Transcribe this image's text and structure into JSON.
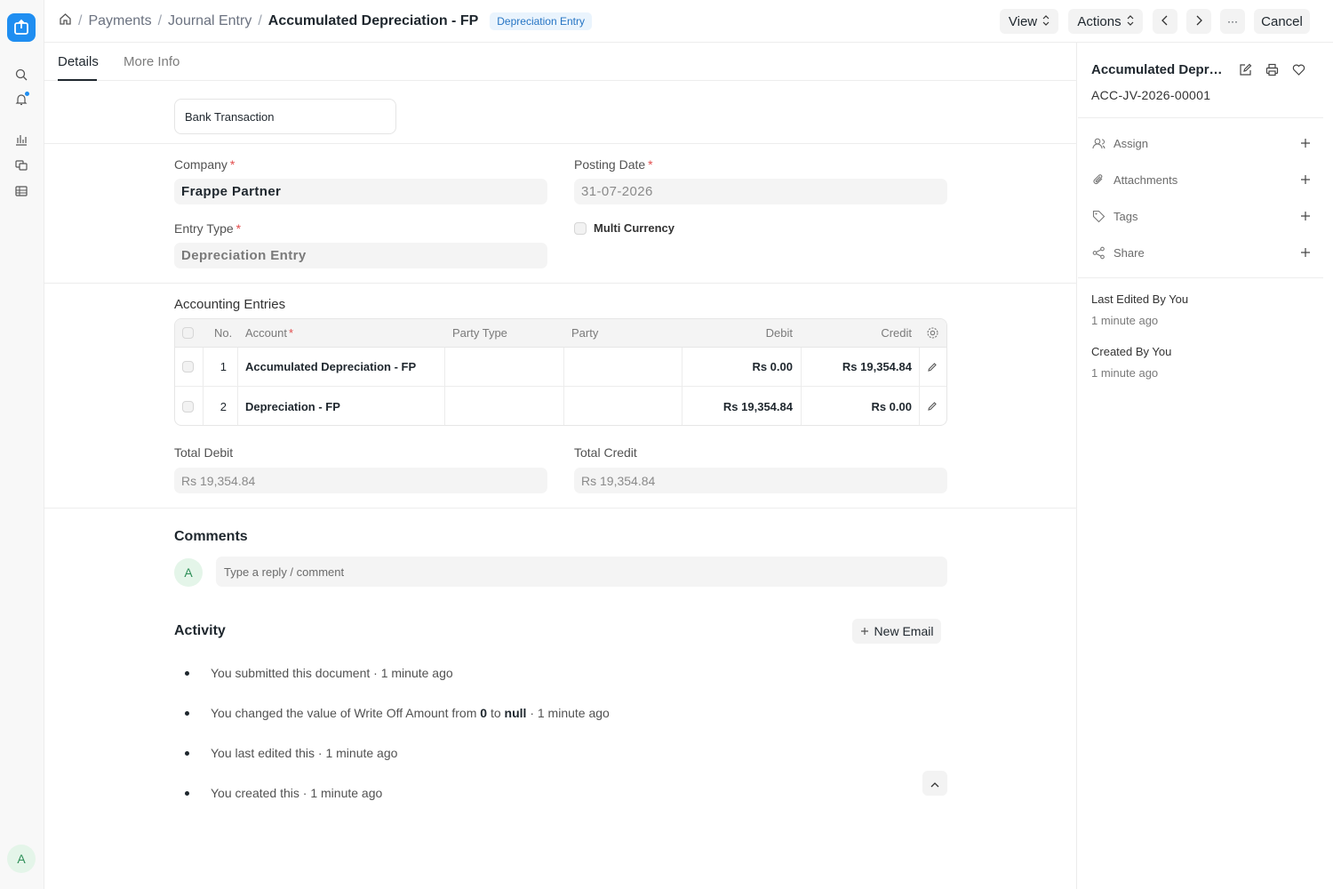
{
  "breadcrumbs": {
    "items": [
      "Payments",
      "Journal Entry"
    ],
    "current": "Accumulated Depreciation - FP",
    "badge": "Depreciation Entry"
  },
  "toolbar": {
    "view_label": "View",
    "actions_label": "Actions",
    "more_label": "···",
    "cancel_label": "Cancel"
  },
  "tabs": [
    {
      "label": "Details",
      "active": true
    },
    {
      "label": "More Info",
      "active": false
    }
  ],
  "form": {
    "bank_transaction_label": "Bank Transaction",
    "company_label": "Company",
    "company_value": "Frappe Partner",
    "posting_date_label": "Posting Date",
    "posting_date_value": "31-07-2026",
    "entry_type_label": "Entry Type",
    "entry_type_value": "Depreciation Entry",
    "multi_currency_label": "Multi Currency",
    "required_mark": "*"
  },
  "accounting_entries": {
    "title": "Accounting Entries",
    "columns": [
      "No.",
      "Account",
      "Party Type",
      "Party",
      "Debit",
      "Credit"
    ],
    "rows": [
      {
        "no": "1",
        "account": "Accumulated Depreciation - FP",
        "party_type": "",
        "party": "",
        "debit": "Rs 0.00",
        "credit": "Rs 19,354.84"
      },
      {
        "no": "2",
        "account": "Depreciation - FP",
        "party_type": "",
        "party": "",
        "debit": "Rs 19,354.84",
        "credit": "Rs 0.00"
      }
    ]
  },
  "totals": {
    "total_debit_label": "Total Debit",
    "total_debit_value": "Rs 19,354.84",
    "total_credit_label": "Total Credit",
    "total_credit_value": "Rs 19,354.84"
  },
  "comments": {
    "title": "Comments",
    "avatar_initial": "A",
    "placeholder": "Type a reply / comment"
  },
  "activity": {
    "title": "Activity",
    "new_email_label": "New Email",
    "items": [
      {
        "text": "You submitted this document",
        "time": "· 1 minute ago"
      },
      {
        "text": "You changed the value of Write Off Amount from",
        "from": "0",
        "to_word": "to",
        "to": "null",
        "time": "· 1 minute ago"
      },
      {
        "text": "You last edited this",
        "time": "· 1 minute ago"
      },
      {
        "text": "You created this",
        "time": "· 1 minute ago"
      }
    ]
  },
  "sidebar": {
    "doc_title": "Accumulated Depreciation - FP",
    "doc_name": "ACC-JV-2026-00001",
    "actions": [
      {
        "label": "Assign",
        "icon": "assign-icon"
      },
      {
        "label": "Attachments",
        "icon": "paperclip-icon"
      },
      {
        "label": "Tags",
        "icon": "tag-icon"
      },
      {
        "label": "Share",
        "icon": "share-icon"
      }
    ],
    "last_edited_label": "Last Edited By You",
    "last_edited_time": "1 minute ago",
    "created_label": "Created By You",
    "created_time": "1 minute ago"
  },
  "user": {
    "avatar_initial": "A"
  },
  "colors": {
    "accent": "#1f8ef1",
    "required": "#e24c4c",
    "badge_bg": "#eaf4fd",
    "badge_text": "#2675c4"
  }
}
